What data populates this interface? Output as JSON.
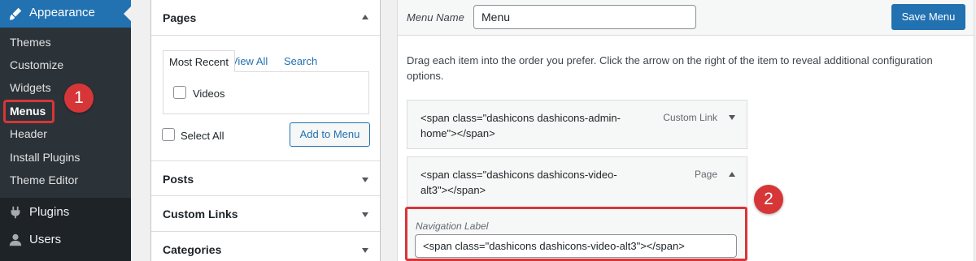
{
  "sidebar": {
    "current_menu": {
      "label": "Appearance",
      "icon": "paintbrush-icon"
    },
    "submenu": [
      {
        "label": "Themes"
      },
      {
        "label": "Customize"
      },
      {
        "label": "Widgets"
      },
      {
        "label": "Menus",
        "current": true
      },
      {
        "label": "Header"
      },
      {
        "label": "Install Plugins"
      },
      {
        "label": "Theme Editor"
      }
    ],
    "menu": [
      {
        "label": "Plugins",
        "icon": "plug-icon"
      },
      {
        "label": "Users",
        "icon": "user-icon"
      }
    ]
  },
  "annotations": {
    "step1": "1",
    "step2": "2"
  },
  "add_items": {
    "pages": {
      "title": "Pages",
      "tabs": {
        "most_recent": "Most Recent",
        "view_all": "View All",
        "search": "Search"
      },
      "items": [
        {
          "label": "Videos"
        }
      ],
      "select_all": "Select All",
      "add_button": "Add to Menu"
    },
    "sections": [
      {
        "title": "Posts"
      },
      {
        "title": "Custom Links"
      },
      {
        "title": "Categories"
      }
    ]
  },
  "menu_editor": {
    "menu_name_label": "Menu Name",
    "menu_name_value": "Menu",
    "save_button": "Save Menu",
    "instructions": "Drag each item into the order you prefer. Click the arrow on the right of the item to reveal additional configuration options.",
    "items": [
      {
        "title": "<span class=\"dashicons dashicons-admin-home\"></span>",
        "type": "Custom Link",
        "expanded": false
      },
      {
        "title": "<span class=\"dashicons dashicons-video-alt3\"></span>",
        "type": "Page",
        "expanded": true
      }
    ],
    "nav_label_caption": "Navigation Label",
    "nav_label_value": "<span class=\"dashicons dashicons-video-alt3\"></span>"
  },
  "colors": {
    "accent": "#2271b1",
    "sidebar": "#1d2327",
    "annotation": "#d63638"
  }
}
